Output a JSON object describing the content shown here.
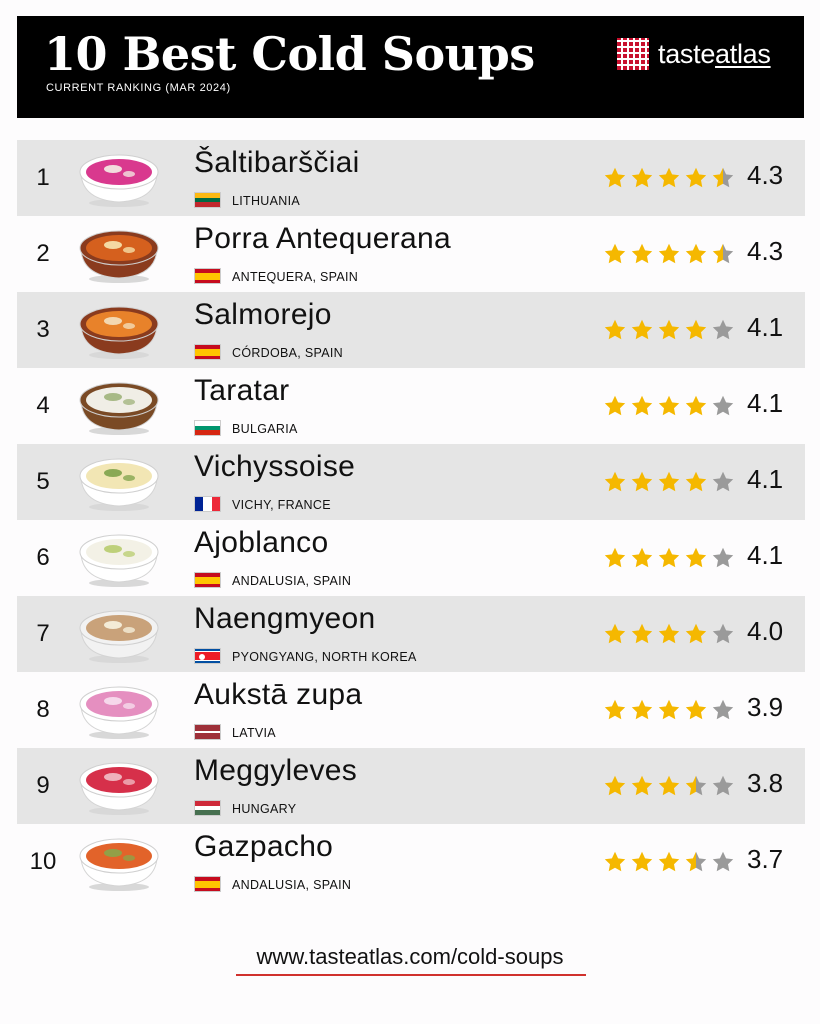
{
  "header": {
    "title": "10 Best Cold Soups",
    "subtitle": "CURRENT RANKING (MAR 2024)",
    "logo_text_prefix": "taste",
    "logo_text_suffix": "atlas"
  },
  "items": [
    {
      "rank": "1",
      "name": "Šaltibarščiai",
      "region": "LITHUANIA",
      "rating": "4.3",
      "rating_value": 4.3,
      "flag": "lithuania",
      "bowl": {
        "rim": "#ffffff",
        "soup": "#d9398e",
        "accent": "#f4f0e6"
      }
    },
    {
      "rank": "2",
      "name": "Porra Antequerana",
      "region": "ANTEQUERA, SPAIN",
      "rating": "4.3",
      "rating_value": 4.3,
      "flag": "spain",
      "bowl": {
        "rim": "#8a3b1e",
        "soup": "#d5601e",
        "accent": "#f7e7b0"
      }
    },
    {
      "rank": "3",
      "name": "Salmorejo",
      "region": "CÓRDOBA, SPAIN",
      "rating": "4.1",
      "rating_value": 4.1,
      "flag": "spain",
      "bowl": {
        "rim": "#8a3b1e",
        "soup": "#e8822a",
        "accent": "#f4e1c0"
      }
    },
    {
      "rank": "4",
      "name": "Taratar",
      "region": "BULGARIA",
      "rating": "4.1",
      "rating_value": 4.1,
      "flag": "bulgaria",
      "bowl": {
        "rim": "#7a4a25",
        "soup": "#f0eee6",
        "accent": "#9fb27a"
      }
    },
    {
      "rank": "5",
      "name": "Vichyssoise",
      "region": "VICHY, FRANCE",
      "rating": "4.1",
      "rating_value": 4.1,
      "flag": "france",
      "bowl": {
        "rim": "#ffffff",
        "soup": "#f2e6b4",
        "accent": "#7ea24a"
      }
    },
    {
      "rank": "6",
      "name": "Ajoblanco",
      "region": "ANDALUSIA, SPAIN",
      "rating": "4.1",
      "rating_value": 4.1,
      "flag": "spain",
      "bowl": {
        "rim": "#ffffff",
        "soup": "#f3f1e6",
        "accent": "#b8cc6e"
      }
    },
    {
      "rank": "7",
      "name": "Naengmyeon",
      "region": "PYONGYANG, NORTH KOREA",
      "rating": "4.0",
      "rating_value": 4.0,
      "flag": "northkorea",
      "bowl": {
        "rim": "#f2f2f2",
        "soup": "#c9a27a",
        "accent": "#f7f3e0"
      }
    },
    {
      "rank": "8",
      "name": "Aukstā zupa",
      "region": "LATVIA",
      "rating": "3.9",
      "rating_value": 3.9,
      "flag": "latvia",
      "bowl": {
        "rim": "#ffffff",
        "soup": "#e58fc0",
        "accent": "#f7e0ef"
      }
    },
    {
      "rank": "9",
      "name": "Meggyleves",
      "region": "HUNGARY",
      "rating": "3.8",
      "rating_value": 3.8,
      "flag": "hungary",
      "bowl": {
        "rim": "#ffffff",
        "soup": "#d6304a",
        "accent": "#f2c0c8"
      }
    },
    {
      "rank": "10",
      "name": "Gazpacho",
      "region": "ANDALUSIA, SPAIN",
      "rating": "3.7",
      "rating_value": 3.7,
      "flag": "spain",
      "bowl": {
        "rim": "#ffffff",
        "soup": "#e2632a",
        "accent": "#8aa54a"
      }
    }
  ],
  "footer": {
    "url": "www.tasteatlas.com/cold-soups"
  },
  "colors": {
    "star_filled": "#f5b800",
    "star_empty": "#9a9a9a",
    "row_shade": "#e5e5e5",
    "url_underline": "#d0312d"
  }
}
